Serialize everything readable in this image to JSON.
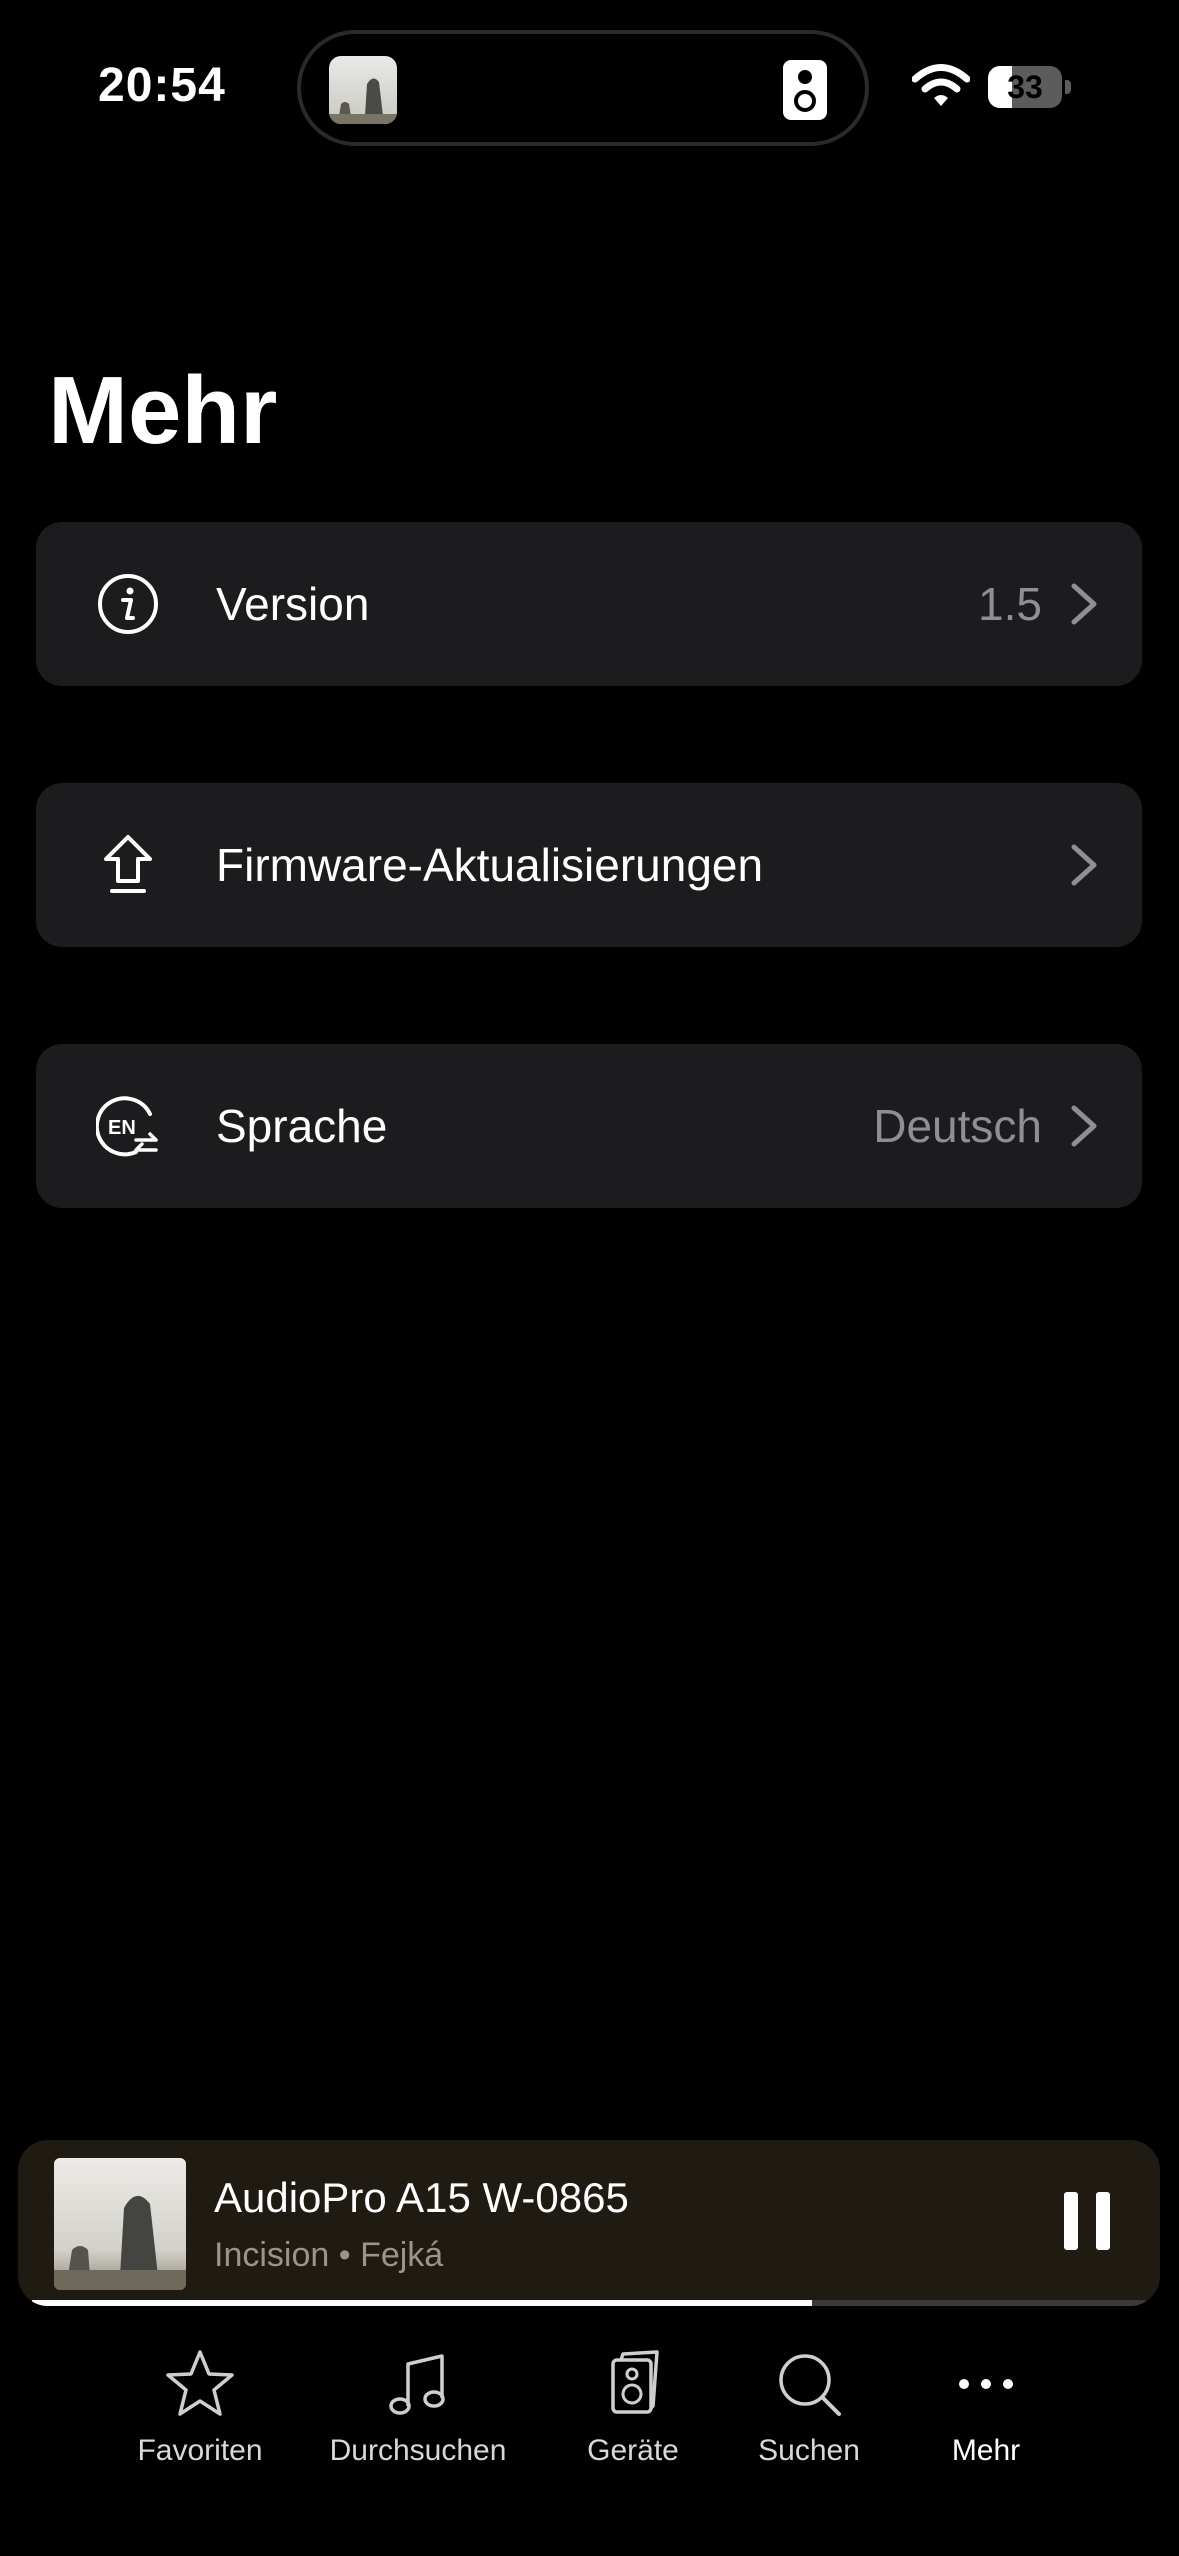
{
  "status_bar": {
    "time": "20:54",
    "battery_level": "33",
    "battery_fraction": 0.33,
    "wifi_icon": "wifi-icon",
    "island_icons": [
      "album-art",
      "speaker-icon"
    ]
  },
  "page": {
    "title": "Mehr"
  },
  "settings": [
    {
      "icon": "info-icon",
      "label": "Version",
      "value": "1.5"
    },
    {
      "icon": "upload-arrow-icon",
      "label": "Firmware-Aktualisierungen",
      "value": ""
    },
    {
      "icon": "language-en-icon",
      "label": "Sprache",
      "value": "Deutsch"
    }
  ],
  "now_playing": {
    "title": "AudioPro A15 W-0865",
    "subtitle": "Incision • Fejká",
    "progress_fraction": 0.7,
    "pause_icon": "pause-icon"
  },
  "tab_bar": {
    "items": [
      {
        "icon": "star-icon",
        "label": "Favoriten"
      },
      {
        "icon": "music-note-icon",
        "label": "Durchsuchen"
      },
      {
        "icon": "speaker-icon",
        "label": "Geräte"
      },
      {
        "icon": "search-icon",
        "label": "Suchen"
      },
      {
        "icon": "more-dots-icon",
        "label": "Mehr"
      }
    ],
    "active": "Mehr"
  },
  "colors": {
    "background": "#000000",
    "row_background": "#1c1c1e",
    "secondary_text": "#8e8e93",
    "player_background": "#1f1a12"
  }
}
